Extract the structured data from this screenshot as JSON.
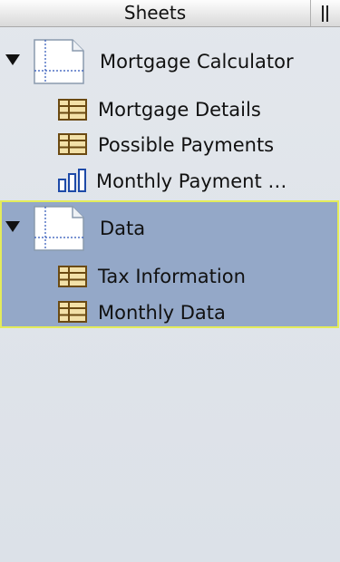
{
  "header": {
    "title": "Sheets"
  },
  "sheets": [
    {
      "label": "Mortgage Calculator",
      "expanded": true,
      "items": [
        {
          "label": "Mortgage Details",
          "icon": "table-icon"
        },
        {
          "label": "Possible Payments",
          "icon": "table-icon"
        },
        {
          "label": "Monthly Payment …",
          "icon": "bar-chart-icon"
        }
      ]
    },
    {
      "label": "Data",
      "expanded": true,
      "selected": true,
      "items": [
        {
          "label": "Tax Information",
          "icon": "table-icon"
        },
        {
          "label": "Monthly Data",
          "icon": "table-icon"
        }
      ]
    }
  ],
  "colors": {
    "selection": "#94a8c8",
    "selection_border": "#e4ec5a",
    "table_icon": "#c79a3c",
    "chart_icon": "#2f5db8"
  }
}
